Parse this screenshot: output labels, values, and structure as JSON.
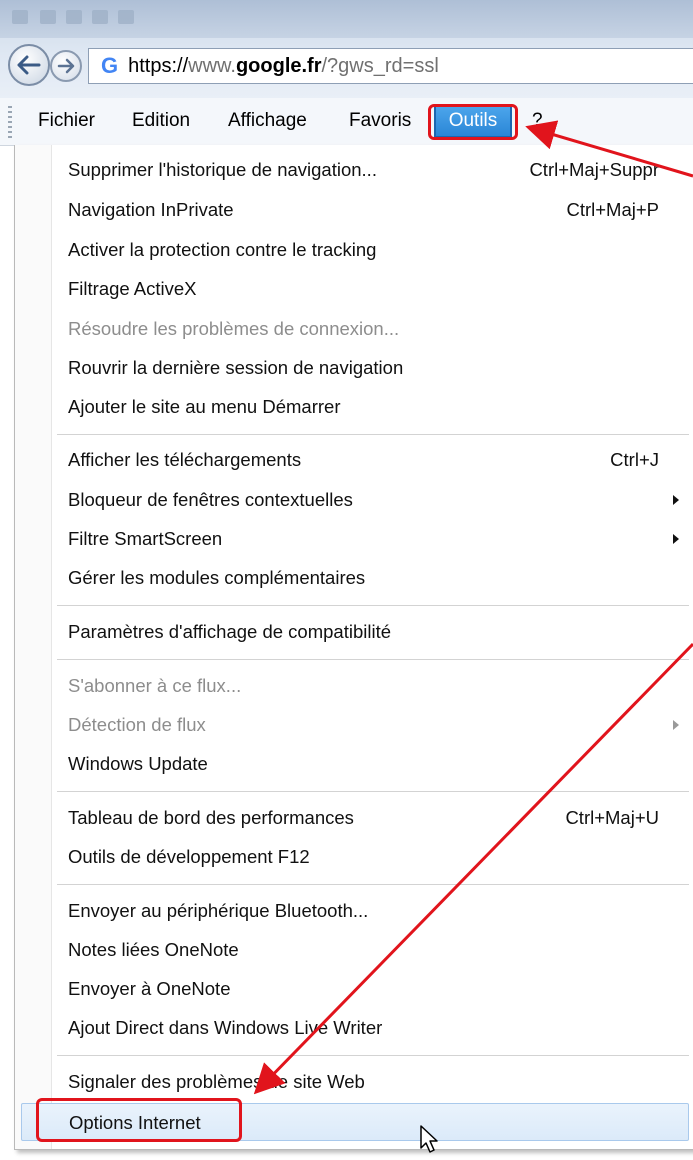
{
  "browser": {
    "address": {
      "scheme": "https://",
      "subdomain": "www.",
      "domain": "google.fr",
      "path": "/?gws_rd=ssl"
    }
  },
  "menubar": {
    "items": [
      "Fichier",
      "Edition",
      "Affichage",
      "Favoris",
      "Outils",
      "?"
    ],
    "active": "Outils"
  },
  "menu": {
    "items": [
      {
        "label": "Supprimer l'historique de navigation...",
        "shortcut": "Ctrl+Maj+Suppr"
      },
      {
        "label": "Navigation InPrivate",
        "shortcut": "Ctrl+Maj+P"
      },
      {
        "label": "Activer la protection contre le tracking"
      },
      {
        "label": "Filtrage ActiveX"
      },
      {
        "label": "Résoudre les problèmes de connexion...",
        "disabled": true
      },
      {
        "label": "Rouvrir la dernière session de navigation"
      },
      {
        "label": "Ajouter le site au menu Démarrer"
      },
      {
        "label": "Afficher les téléchargements",
        "shortcut": "Ctrl+J"
      },
      {
        "label": "Bloqueur de fenêtres contextuelles",
        "submenu": true
      },
      {
        "label": "Filtre SmartScreen",
        "submenu": true
      },
      {
        "label": "Gérer les modules complémentaires"
      },
      {
        "label": "Paramètres d'affichage de compatibilité"
      },
      {
        "label": "S'abonner à ce flux...",
        "disabled": true
      },
      {
        "label": "Détection de flux",
        "disabled": true,
        "submenu": true
      },
      {
        "label": "Windows Update"
      },
      {
        "label": "Tableau de bord des performances",
        "shortcut": "Ctrl+Maj+U"
      },
      {
        "label": "Outils de développement F12"
      },
      {
        "label": "Envoyer au périphérique Bluetooth..."
      },
      {
        "label": "Notes liées OneNote"
      },
      {
        "label": "Envoyer à OneNote"
      },
      {
        "label": "Ajout Direct dans Windows Live Writer"
      },
      {
        "label": "Signaler des problèmes de site Web"
      },
      {
        "label": "Options Internet",
        "hovered": true
      }
    ]
  },
  "colors": {
    "annotation": "#e1141c",
    "menu_active": "#2a86d6"
  }
}
